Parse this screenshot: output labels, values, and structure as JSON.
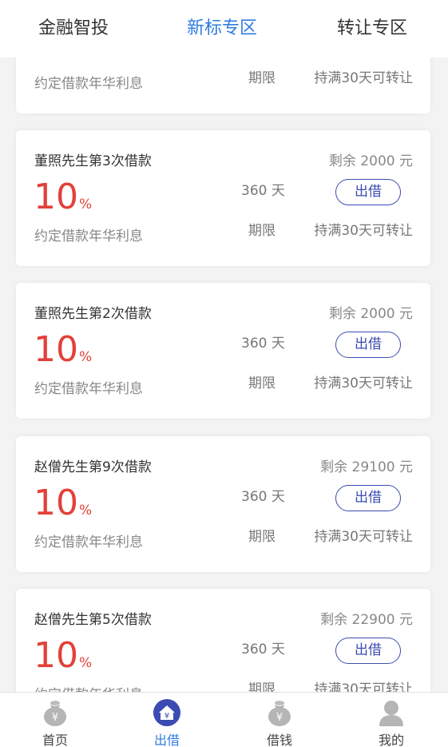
{
  "top_tabs": [
    "金融智投",
    "新标专区",
    "转让专区"
  ],
  "partial_card": {
    "rate_label": "约定借款年华利息",
    "term_label": "期限",
    "transfer_label": "持满30天可转让"
  },
  "cards": [
    {
      "name": "董照先生第3次借款",
      "remaining": "剩余 2000 元",
      "rate_value": "10",
      "rate_unit": "%",
      "term": "360 天",
      "button": "出借",
      "rate_label": "约定借款年华利息",
      "term_label": "期限",
      "transfer_label": "持满30天可转让"
    },
    {
      "name": "董照先生第2次借款",
      "remaining": "剩余 2000 元",
      "rate_value": "10",
      "rate_unit": "%",
      "term": "360 天",
      "button": "出借",
      "rate_label": "约定借款年华利息",
      "term_label": "期限",
      "transfer_label": "持满30天可转让"
    },
    {
      "name": "赵僧先生第9次借款",
      "remaining": "剩余 29100 元",
      "rate_value": "10",
      "rate_unit": "%",
      "term": "360 天",
      "button": "出借",
      "rate_label": "约定借款年华利息",
      "term_label": "期限",
      "transfer_label": "持满30天可转让"
    },
    {
      "name": "赵僧先生第5次借款",
      "remaining": "剩余 22900 元",
      "rate_value": "10",
      "rate_unit": "%",
      "term": "360 天",
      "button": "出借",
      "rate_label": "约定借款年华利息",
      "term_label": "期限",
      "transfer_label": "持满30天可转让"
    }
  ],
  "bottom_nav": [
    {
      "label": "首页",
      "icon": "money-bag-icon",
      "active": false
    },
    {
      "label": "出借",
      "icon": "house-yen-icon",
      "active": true
    },
    {
      "label": "借钱",
      "icon": "money-bag-icon",
      "active": false
    },
    {
      "label": "我的",
      "icon": "user-icon",
      "active": false
    }
  ],
  "colors": {
    "accent": "#2f7de1",
    "rate": "#e2413a",
    "button": "#3b4cb0"
  }
}
